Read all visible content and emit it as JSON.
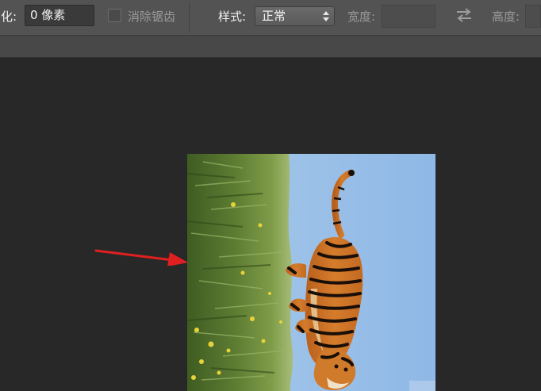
{
  "options_bar": {
    "feather_label": "羽化:",
    "feather_value": "0 像素",
    "antialias_label": "消除锯齿",
    "style_label": "样式:",
    "style_value": "正常",
    "width_label": "宽度:",
    "height_label": "高度:"
  },
  "icons": {
    "select_arrows": "up-down-arrows-icon",
    "swap": "swap-arrows-icon"
  },
  "colors": {
    "annotation_arrow": "#e02020",
    "sky": "#9ec4ea",
    "grass": "#6c8a3a"
  }
}
